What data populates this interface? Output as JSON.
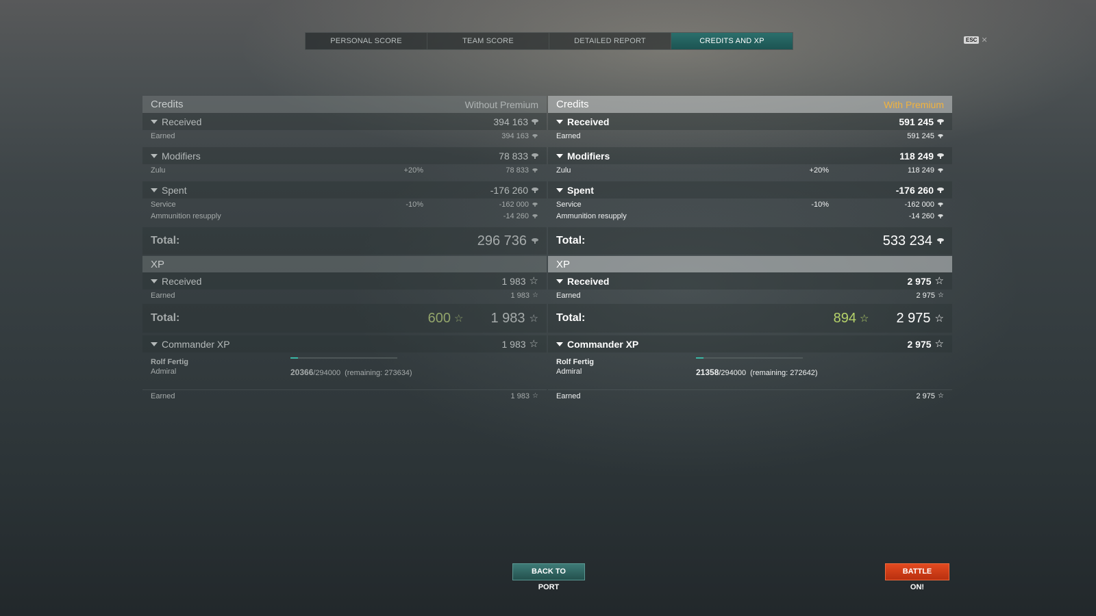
{
  "tabs": [
    {
      "label": "PERSONAL SCORE",
      "active": false
    },
    {
      "label": "TEAM SCORE",
      "active": false
    },
    {
      "label": "DETAILED REPORT",
      "active": false
    },
    {
      "label": "CREDITS AND XP",
      "active": true
    }
  ],
  "esc": {
    "key": "ESC",
    "close": "✕"
  },
  "left": {
    "credits_title": "Credits",
    "premium_label": "Without Premium",
    "received": {
      "label": "Received",
      "value": "394 163",
      "earned_label": "Earned",
      "earned_value": "394 163"
    },
    "modifiers": {
      "label": "Modifiers",
      "value": "78 833",
      "item_label": "Zulu",
      "item_pct": "+20%",
      "item_value": "78 833"
    },
    "spent": {
      "label": "Spent",
      "value": "-176 260",
      "items": [
        {
          "label": "Service",
          "pct": "-10%",
          "value": "-162 000"
        },
        {
          "label": "Ammunition resupply",
          "pct": "",
          "value": "-14 260"
        }
      ]
    },
    "total_label": "Total:",
    "total_value": "296 736",
    "xp_title": "XP",
    "xp_received": {
      "label": "Received",
      "value": "1 983",
      "earned_label": "Earned",
      "earned_value": "1 983"
    },
    "xp_total_label": "Total:",
    "xp_total_base": "600",
    "xp_total_value": "1 983",
    "cmdr_label": "Commander XP",
    "cmdr_value": "1 983",
    "cmdr_name": "Rolf Fertig",
    "cmdr_rank": "Admiral",
    "cmdr_current": "20366",
    "cmdr_max": "/294000",
    "cmdr_remaining": "(remaining: 273634)",
    "cmdr_progress": 0.069,
    "cmdr_earned_label": "Earned",
    "cmdr_earned_value": "1 983"
  },
  "right": {
    "credits_title": "Credits",
    "premium_label": "With Premium",
    "received": {
      "label": "Received",
      "value": "591 245",
      "earned_label": "Earned",
      "earned_value": "591 245"
    },
    "modifiers": {
      "label": "Modifiers",
      "value": "118 249",
      "item_label": "Zulu",
      "item_pct": "+20%",
      "item_value": "118 249"
    },
    "spent": {
      "label": "Spent",
      "value": "-176 260",
      "items": [
        {
          "label": "Service",
          "pct": "-10%",
          "value": "-162 000"
        },
        {
          "label": "Ammunition resupply",
          "pct": "",
          "value": "-14 260"
        }
      ]
    },
    "total_label": "Total:",
    "total_value": "533 234",
    "xp_title": "XP",
    "xp_received": {
      "label": "Received",
      "value": "2 975",
      "earned_label": "Earned",
      "earned_value": "2 975"
    },
    "xp_total_label": "Total:",
    "xp_total_base": "894",
    "xp_total_value": "2 975",
    "cmdr_label": "Commander XP",
    "cmdr_value": "2 975",
    "cmdr_name": "Rolf Fertig",
    "cmdr_rank": "Admiral",
    "cmdr_current": "21358",
    "cmdr_max": "/294000",
    "cmdr_remaining": "(remaining: 272642)",
    "cmdr_progress": 0.073,
    "cmdr_earned_label": "Earned",
    "cmdr_earned_value": "2 975"
  },
  "buttons": {
    "back": "BACK TO PORT",
    "battle": "BATTLE ON!"
  },
  "colors": {
    "accent_teal": "#2b6f6c",
    "premium_gold": "#f2b33d",
    "battle_orange": "#d83c16",
    "xp_green": "#b6d36a"
  }
}
